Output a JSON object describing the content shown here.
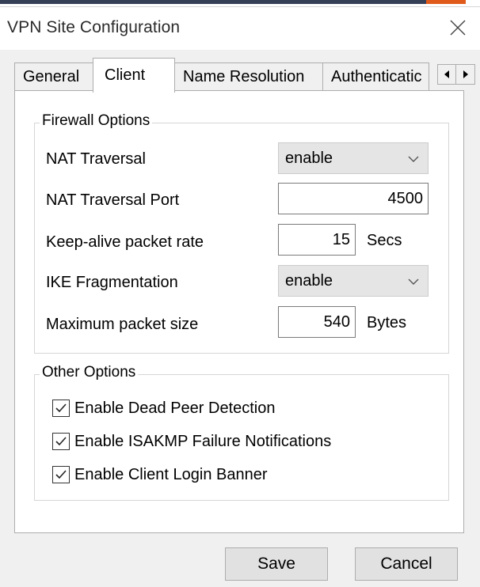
{
  "window": {
    "title": "VPN Site Configuration"
  },
  "tabs": [
    {
      "label": "General",
      "active": false
    },
    {
      "label": "Client",
      "active": true
    },
    {
      "label": "Name Resolution",
      "active": false
    },
    {
      "label": "Authenticatic",
      "active": false
    }
  ],
  "firewall": {
    "group_title": "Firewall Options",
    "nat_traversal": {
      "label": "NAT Traversal",
      "value": "enable"
    },
    "nat_traversal_port": {
      "label": "NAT Traversal Port",
      "value": "4500"
    },
    "keepalive": {
      "label": "Keep-alive packet rate",
      "value": "15",
      "unit": "Secs"
    },
    "ike_fragmentation": {
      "label": "IKE Fragmentation",
      "value": "enable"
    },
    "max_packet_size": {
      "label": "Maximum packet size",
      "value": "540",
      "unit": "Bytes"
    }
  },
  "other": {
    "group_title": "Other Options",
    "options": [
      {
        "label": "Enable Dead Peer Detection",
        "checked": true
      },
      {
        "label": "Enable ISAKMP Failure Notifications",
        "checked": true
      },
      {
        "label": "Enable Client Login Banner",
        "checked": true
      }
    ]
  },
  "buttons": {
    "save_label": "Save",
    "cancel_label": "Cancel"
  },
  "icons": {
    "close": "close-icon",
    "scroll_left": "arrow-left-icon",
    "scroll_right": "arrow-right-icon",
    "dropdown": "chevron-down-icon",
    "check": "checkmark-icon"
  },
  "colors": {
    "window_bg": "#f0f0f0",
    "panel_bg": "#ffffff",
    "dropdown_bg": "#e5e5e5",
    "button_bg": "#e1e1e1"
  }
}
